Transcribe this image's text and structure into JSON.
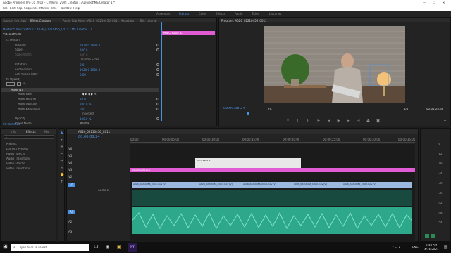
{
  "window": {
    "title": "Adobe Premiere Pro CC 2017 - C:\\Works 2\\MS Creator 17\\project\\MS Creator 1 *"
  },
  "menu": [
    "File",
    "Edit",
    "Clip",
    "Sequence",
    "Marker",
    "Title",
    "Window",
    "Help"
  ],
  "workspaces": [
    "Assembly",
    "Editing",
    "Color",
    "Effects",
    "Audio",
    "Titles",
    "Libraries"
  ],
  "active_workspace": "Editing",
  "top_left_tabs": [
    "Source: (no clips)",
    "Effect Controls",
    "Audio Clip Mixer: A026_02210456_C011",
    "Metadata",
    "Bin: tutorial"
  ],
  "effect_controls": {
    "clip_path": "Master * MS Creator 17  A026_02210456_C011 * MS Creator 17",
    "mini_clip": "MS Creator 17",
    "section": "Video Effects",
    "rows": [
      {
        "label": "fx  Motion",
        "value": ""
      },
      {
        "label": "Position",
        "value": "1920.0   1080.0"
      },
      {
        "label": "Scale",
        "value": "100.0"
      },
      {
        "label": "Scale Width",
        "value": "100.0"
      },
      {
        "label": "",
        "value": "Uniform Scale"
      },
      {
        "label": "Rotation",
        "value": "0.0"
      },
      {
        "label": "Anchor Point",
        "value": "1920.0   1080.0"
      },
      {
        "label": "Anti-flicker Filter",
        "value": "0.00"
      },
      {
        "label": "fx  Opacity",
        "value": ""
      },
      {
        "label": "Mask (1)",
        "value": ""
      },
      {
        "label": "Mask Path",
        "value": ""
      },
      {
        "label": "Mask Feather",
        "value": "10.0"
      },
      {
        "label": "Mask Opacity",
        "value": "100.0 %"
      },
      {
        "label": "Mask Expansion",
        "value": "0.0"
      },
      {
        "label": "",
        "value": "Inverted"
      },
      {
        "label": "Opacity",
        "value": "100.0 %"
      },
      {
        "label": "Blend Mode",
        "value": "Normal"
      }
    ],
    "timecode": "00:00:08:24"
  },
  "program": {
    "title": "Program: A026_02210456_C011",
    "timecode": "00:00:08:24",
    "fit": "Fit",
    "quality": "1/4",
    "duration": "00:01:24:48"
  },
  "project": {
    "tabs": [
      "Info",
      "Effects",
      "Mar"
    ],
    "items": [
      "Presets",
      "Lumetri Presets",
      "Audio Effects",
      "Audio Transitions",
      "Video Effects",
      "Video Transitions"
    ]
  },
  "timeline": {
    "tab": "A026_02210456_C011",
    "timecode": "00:00:08:24",
    "ruler": [
      "00:00",
      "00:00:05:00",
      "00:00:10:00",
      "00:00:15:00",
      "00:00:20:00",
      "00:00:25:00",
      "00:00:30:00",
      "00:00:35:00"
    ],
    "video_tracks": [
      "V6",
      "V5",
      "V4",
      "V3",
      "V2",
      "V1"
    ],
    "audio_tracks": [
      "A1",
      "A2",
      "A3"
    ],
    "audio_label": "Audio 1",
    "clips": {
      "v4": "MS Creator 17",
      "adjustment": "Adjustment Layer",
      "v1": [
        "A026_02210456_C011.mov [V]",
        "A026_02210456_C013.mov [V]",
        "A026_02210456_C014.mov [V]",
        "A026_02210456_C020.mov [V]",
        "A026_02210451_C008.mov [V]"
      ]
    }
  },
  "audio_meter": {
    "levels": [
      "-6",
      "-12",
      "-18",
      "-24",
      "-30",
      "-36",
      "-42",
      "-48",
      "-54"
    ]
  },
  "taskbar": {
    "search": "Type here to search",
    "time": "3:48 AM",
    "date": "4/16/2021",
    "lang": "ENG"
  },
  "colors": {
    "accent": "#4a90e2",
    "pink": "#e15bd4",
    "video_clip": "#9ab8e0",
    "audio_clip": "#2da88a"
  }
}
